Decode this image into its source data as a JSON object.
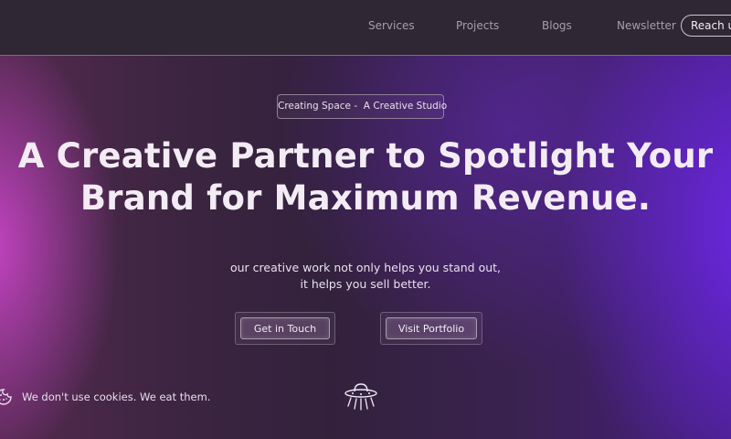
{
  "nav": {
    "links": [
      "Services",
      "Projects",
      "Blogs",
      "Newsletter"
    ],
    "cta": "Reach us"
  },
  "hero": {
    "badge": "Creating Space -  A Creative Studio",
    "headline_line1": "A Creative Partner to Spotlight Your",
    "headline_line2": "Brand for Maximum Revenue.",
    "sub_line1": "our creative work not only helps you stand out,",
    "sub_line2": "it helps you sell better.",
    "primary_button": "Get in Touch",
    "secondary_button": "Visit Portfolio"
  },
  "cookie": {
    "text": "We don't use cookies. We eat them.",
    "icon": "cookie-icon"
  },
  "decor": {
    "icon": "ufo-icon"
  },
  "colors": {
    "accent_purple": "#6e28eb",
    "accent_pink": "#d648d6",
    "text": "#f3ecf4"
  }
}
